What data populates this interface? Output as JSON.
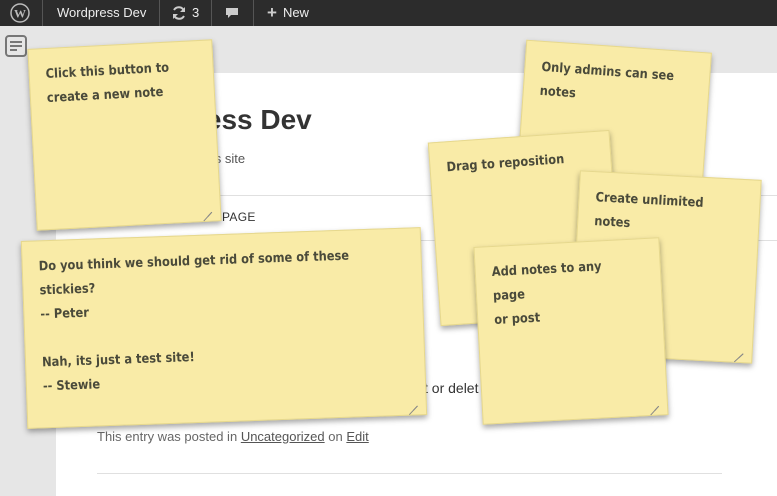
{
  "adminbar": {
    "site_name": "Wordpress Dev",
    "updates_count": "3",
    "new_label": "New"
  },
  "page": {
    "site_title": "ress Dev",
    "site_desc": "ess site",
    "nav_page": "PAGE",
    "post_fragment": "t or delet",
    "posted_prefix": "This entry was posted in",
    "category": "Uncategorized",
    "posted_on": "on",
    "edit": "Edit"
  },
  "notes": [
    {
      "text": "Click this button to\ncreate a new note"
    },
    {
      "text": "Do you think we should get rid of some of these stickies?\n-- Peter\n\nNah, its just a test site!\n-- Stewie"
    },
    {
      "text": "Only admins can see\nnotes"
    },
    {
      "text": "Drag to reposition"
    },
    {
      "text": "Create unlimited notes"
    },
    {
      "text": "Add notes to any page\nor post"
    }
  ],
  "colors": {
    "adminbar": "#2c2c2c",
    "note_bg": "#f9eba7"
  }
}
